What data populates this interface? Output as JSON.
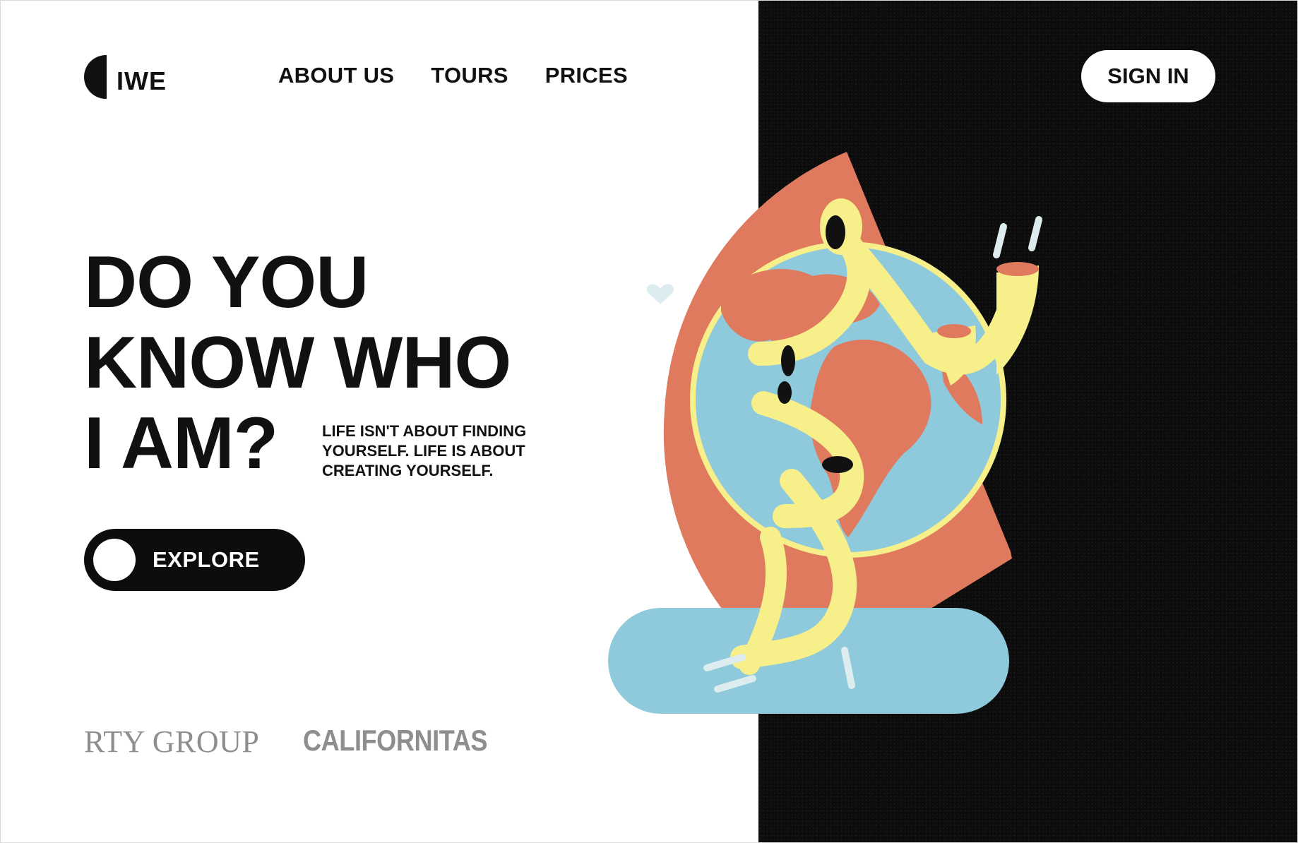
{
  "brand": {
    "name": "IWE"
  },
  "nav": {
    "items": [
      {
        "label": "ABOUT US"
      },
      {
        "label": "TOURS"
      },
      {
        "label": "PRICES"
      }
    ],
    "sign_in_label": "SIGN IN"
  },
  "hero": {
    "headline_lines": [
      "DO YOU",
      "KNOW WHO",
      "I AM?"
    ],
    "tagline_lines": [
      "LIFE ISN'T ABOUT FINDING",
      "YOURSELF. LIFE IS ABOUT",
      "CREATING YOURSELF."
    ],
    "cta_label": "EXPLORE"
  },
  "partners": [
    {
      "name": "RTY GROUP"
    },
    {
      "name": "CALIFORNITAS"
    }
  ],
  "colors": {
    "accent_orange": "#e07a5f",
    "globe_blue": "#8ecadb",
    "figure_yellow": "#f6ef8a",
    "dark_panel": "#0b0b0b",
    "partner_gray": "#8e8e8e"
  },
  "icons": {
    "logo_mark": "half-circle-logo-icon",
    "cta_dot": "circle-dot-icon"
  }
}
